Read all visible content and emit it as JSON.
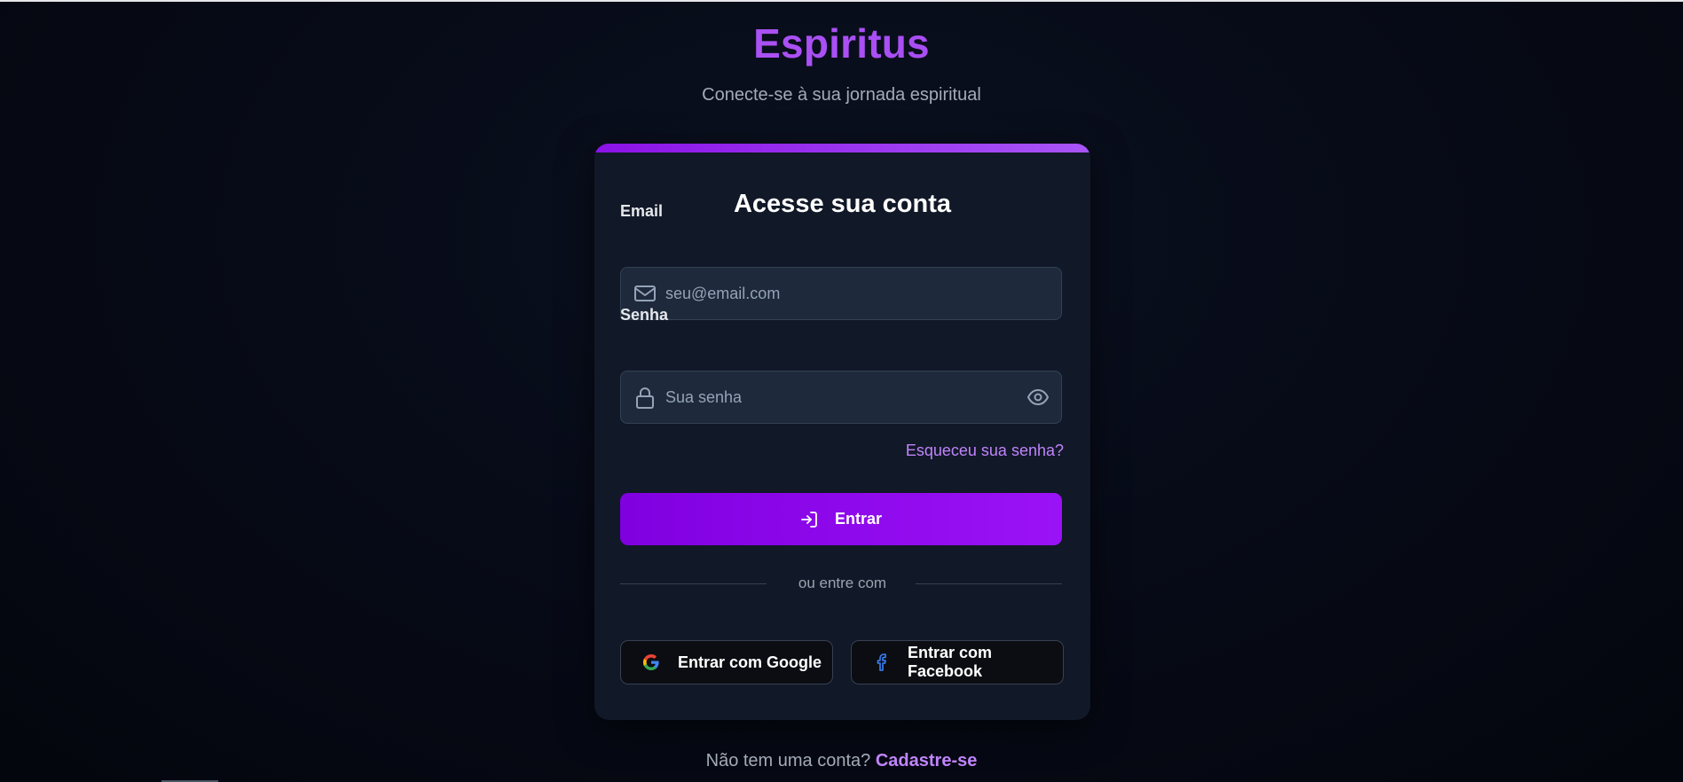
{
  "brand": "Espiritus",
  "tagline": "Conecte-se à sua jornada espiritual",
  "login": {
    "title": "Acesse sua conta",
    "email_label": "Email",
    "email_placeholder": "seu@email.com",
    "password_label": "Senha",
    "password_placeholder": "Sua senha",
    "forgot_link": "Esqueceu sua senha?",
    "submit_label": "Entrar",
    "divider_text": "ou entre com",
    "google_label": "Entrar com Google",
    "facebook_label": "Entrar com Facebook"
  },
  "footer": {
    "prompt": "Não tem uma conta?",
    "signup_link": "Cadastre-se"
  },
  "icons": {
    "email": "mail-icon",
    "password": "lock-icon",
    "toggle": "eye-icon",
    "submit": "login-icon",
    "google": "google-icon",
    "facebook": "facebook-icon"
  },
  "colors": {
    "accent": "#9b12f6",
    "brand": "#a855f7",
    "link": "#c084fc",
    "card": "#111827",
    "background": "#070b18"
  }
}
